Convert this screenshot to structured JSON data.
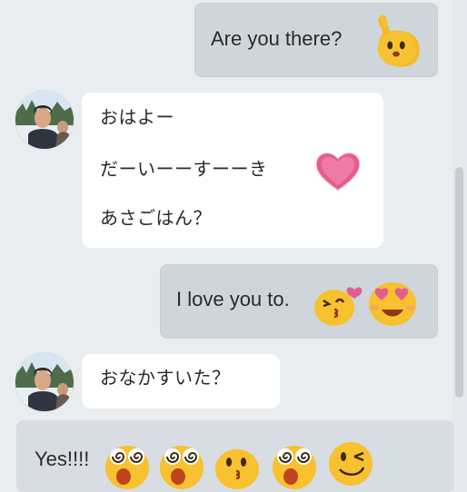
{
  "messages": {
    "m1": {
      "text": "Are you there?",
      "emoji": "waving-hand-face-icon"
    },
    "m2": {
      "lines": [
        "おはよー",
        "だーいーーすーーき",
        "あさごはん？"
      ],
      "emoji": "heart-icon",
      "avatar": "avatar-photo"
    },
    "m3": {
      "text": "I love you to.",
      "emojis": [
        "kissing-face-icon",
        "heart-eyes-face-icon"
      ]
    },
    "m4": {
      "text": "おなかすいた？",
      "avatar": "avatar-photo"
    },
    "m5": {
      "text": "Yes!!!!",
      "emojis": [
        "dizzy-face-icon",
        "dizzy-face-icon",
        "kissing-face-icon",
        "dizzy-face-icon",
        "winking-face-icon"
      ]
    }
  },
  "colors": {
    "background": "#e9edf0",
    "outgoing_bubble": "#cfd6db",
    "incoming_bubble": "#ffffff",
    "emoji_yellow": "#f7c130",
    "heart_pink": "#e45d8f"
  }
}
